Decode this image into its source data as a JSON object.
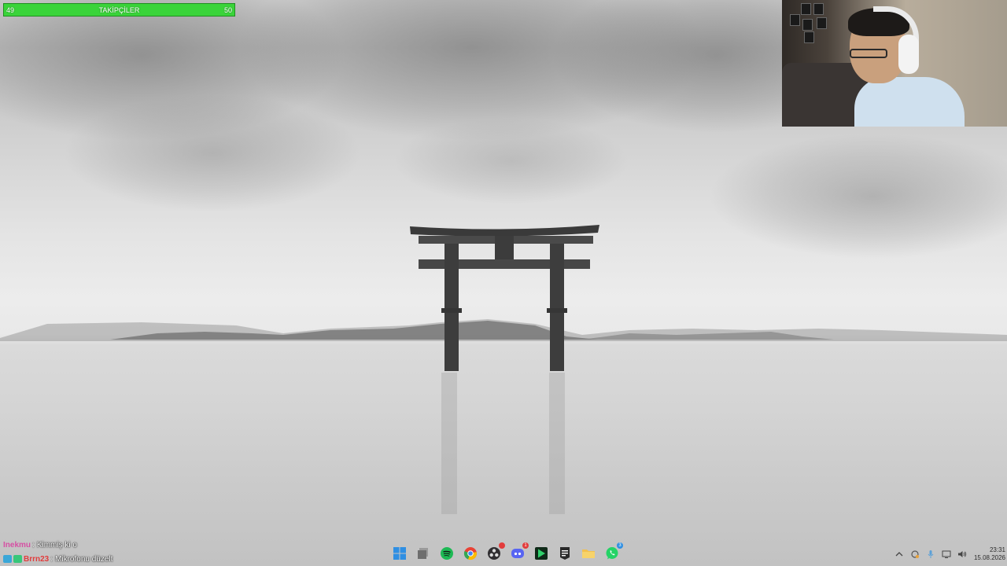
{
  "overlay": {
    "goal": {
      "title": "TAKİPÇİLER",
      "current": "49",
      "target": "50",
      "progress_fraction": 0.98,
      "color": "#3ad43a"
    },
    "chat": [
      {
        "user": "Inekmu",
        "user_color": "#d64fa3",
        "separator": ":",
        "message": "Kimmiş ki o",
        "badges": []
      },
      {
        "user": "Brrn23",
        "user_color": "#e23b3b",
        "separator": ":",
        "message": "Mikrofonu düzelt",
        "badges": [
          "#3aa7d8",
          "#37c77a"
        ]
      }
    ]
  },
  "taskbar": {
    "apps": [
      {
        "name": "start-icon",
        "color": "#2f8fe3"
      },
      {
        "name": "task-view-icon",
        "color": "#7a7a7a"
      },
      {
        "name": "spotify-icon",
        "color": "#1db954"
      },
      {
        "name": "chrome-icon",
        "color": "#e94235"
      },
      {
        "name": "obs-icon",
        "color": "#302e31",
        "badge": "",
        "badge_color": "#e23b3b"
      },
      {
        "name": "discord-icon",
        "color": "#5865f2",
        "badge": "1",
        "badge_color": "#e23b3b"
      },
      {
        "name": "streamlabs-icon",
        "color": "#1f7a3a"
      },
      {
        "name": "epic-games-icon",
        "color": "#2a2a2a"
      },
      {
        "name": "file-explorer-icon",
        "color": "#f2c14e"
      },
      {
        "name": "whatsapp-icon",
        "color": "#25d366",
        "badge": "3",
        "badge_color": "#2f8fe3"
      }
    ],
    "tray": {
      "icons": [
        "chevron-up-icon",
        "sync-icon",
        "microphone-icon",
        "display-icon",
        "volume-icon"
      ],
      "time": "23:31",
      "date": "15.08.2026"
    }
  }
}
